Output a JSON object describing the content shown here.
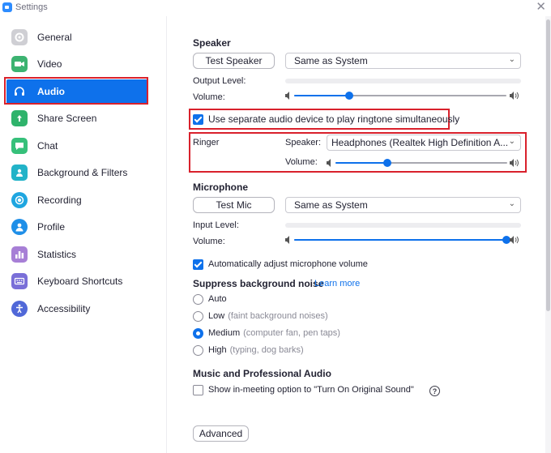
{
  "window": {
    "title": "Settings"
  },
  "colors": {
    "accent": "#0e71eb",
    "highlight": "#d9212c"
  },
  "sidebar": {
    "items": [
      {
        "label": "General",
        "icon": "gear-icon",
        "color": "#cfcfd4"
      },
      {
        "label": "Video",
        "icon": "video-camera-icon",
        "color": "#3cb371"
      },
      {
        "label": "Audio",
        "icon": "headphones-icon",
        "color": "#0e71eb",
        "active": true
      },
      {
        "label": "Share Screen",
        "icon": "share-screen-icon",
        "color": "#2fb36b"
      },
      {
        "label": "Chat",
        "icon": "chat-bubble-icon",
        "color": "#36c07a"
      },
      {
        "label": "Background & Filters",
        "icon": "person-background-icon",
        "color": "#22b3c8"
      },
      {
        "label": "Recording",
        "icon": "record-icon",
        "color": "#1fa6e0"
      },
      {
        "label": "Profile",
        "icon": "person-icon",
        "color": "#1f8fe8"
      },
      {
        "label": "Statistics",
        "icon": "bar-chart-icon",
        "color": "#a77fd6"
      },
      {
        "label": "Keyboard Shortcuts",
        "icon": "keyboard-icon",
        "color": "#7a6fd8"
      },
      {
        "label": "Accessibility",
        "icon": "accessibility-icon",
        "color": "#5068d8"
      }
    ]
  },
  "speaker": {
    "title": "Speaker",
    "test_button": "Test Speaker",
    "device": "Same as System",
    "output_level_label": "Output Level:",
    "volume_label": "Volume:",
    "volume": 0.26
  },
  "ringtone": {
    "checkbox_label": "Use separate audio device to play ringtone simultaneously",
    "checked": true
  },
  "ringer": {
    "title": "Ringer",
    "speaker_label": "Speaker:",
    "device": "Headphones (Realtek High Definition A...",
    "volume_label": "Volume:",
    "volume": 0.3
  },
  "microphone": {
    "title": "Microphone",
    "test_button": "Test Mic",
    "device": "Same as System",
    "input_level_label": "Input Level:",
    "volume_label": "Volume:",
    "volume": 1.0,
    "auto_adjust_label": "Automatically adjust microphone volume",
    "auto_adjust": true
  },
  "suppress": {
    "title": "Suppress background noise",
    "learn_more": "Learn more",
    "options": [
      {
        "label": "Auto",
        "sub": ""
      },
      {
        "label": "Low",
        "sub": "(faint background noises)"
      },
      {
        "label": "Medium",
        "sub": "(computer fan, pen taps)",
        "selected": true
      },
      {
        "label": "High",
        "sub": "(typing, dog barks)"
      }
    ]
  },
  "music": {
    "title": "Music and Professional Audio",
    "original_sound_label": "Show in-meeting option to \"Turn On Original Sound\"",
    "help_icon": "?"
  },
  "advanced_button": "Advanced"
}
